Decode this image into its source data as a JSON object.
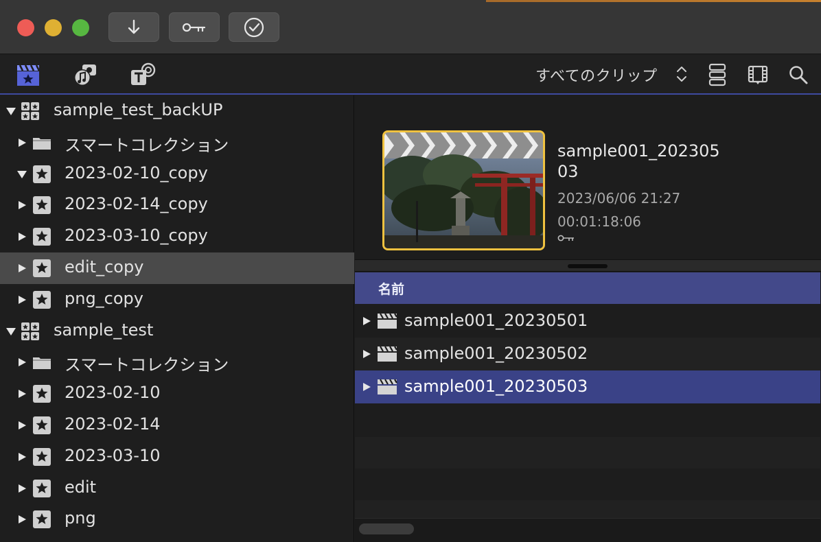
{
  "window": {
    "toolbar_buttons": [
      {
        "icon": "download-arrow-icon"
      },
      {
        "icon": "key-icon"
      },
      {
        "icon": "checkmark-circle-icon"
      }
    ]
  },
  "browser_toolbar": {
    "tools": [
      {
        "icon": "clapper-star-icon",
        "active": true
      },
      {
        "icon": "photos-music-icon",
        "active": false
      },
      {
        "icon": "titles-generators-icon",
        "active": false
      }
    ],
    "clip_filter": "すべてのクリップ",
    "right_icons": [
      "clip-appearance-icon",
      "filmstrip-icon",
      "search-icon"
    ]
  },
  "sidebar": {
    "items": [
      {
        "label": "sample_test_backUP",
        "type": "library",
        "level": 0,
        "expanded": true
      },
      {
        "label": "スマートコレクション",
        "type": "folder",
        "level": 1,
        "expanded": false
      },
      {
        "label": "2023-02-10_copy",
        "type": "event",
        "level": 1,
        "expanded": true
      },
      {
        "label": "2023-02-14_copy",
        "type": "event",
        "level": 1,
        "expanded": false
      },
      {
        "label": "2023-03-10_copy",
        "type": "event",
        "level": 1,
        "expanded": false
      },
      {
        "label": "edit_copy",
        "type": "event",
        "level": 1,
        "expanded": false,
        "selected": true
      },
      {
        "label": "png_copy",
        "type": "event",
        "level": 1,
        "expanded": false
      },
      {
        "label": "sample_test",
        "type": "library",
        "level": 0,
        "expanded": true
      },
      {
        "label": "スマートコレクション",
        "type": "folder",
        "level": 1,
        "expanded": false
      },
      {
        "label": "2023-02-10",
        "type": "event",
        "level": 1,
        "expanded": false
      },
      {
        "label": "2023-02-14",
        "type": "event",
        "level": 1,
        "expanded": false
      },
      {
        "label": "2023-03-10",
        "type": "event",
        "level": 1,
        "expanded": false
      },
      {
        "label": "edit",
        "type": "event",
        "level": 1,
        "expanded": false
      },
      {
        "label": "png",
        "type": "event",
        "level": 1,
        "expanded": false
      }
    ]
  },
  "inspector": {
    "clip_name": "sample001_20230503",
    "date": "2023/06/06 21:27",
    "duration": "00:01:18:06"
  },
  "list": {
    "column_name": "名前",
    "rows": [
      {
        "label": "sample001_20230501",
        "selected": false
      },
      {
        "label": "sample001_20230502",
        "selected": false
      },
      {
        "label": "sample001_20230503",
        "selected": true
      }
    ]
  },
  "colors": {
    "selection_blue": "#3a4287",
    "header_blue": "#43498a",
    "accent_yellow": "#f0c23f",
    "sidebar_selected": "#4a4a4a"
  }
}
